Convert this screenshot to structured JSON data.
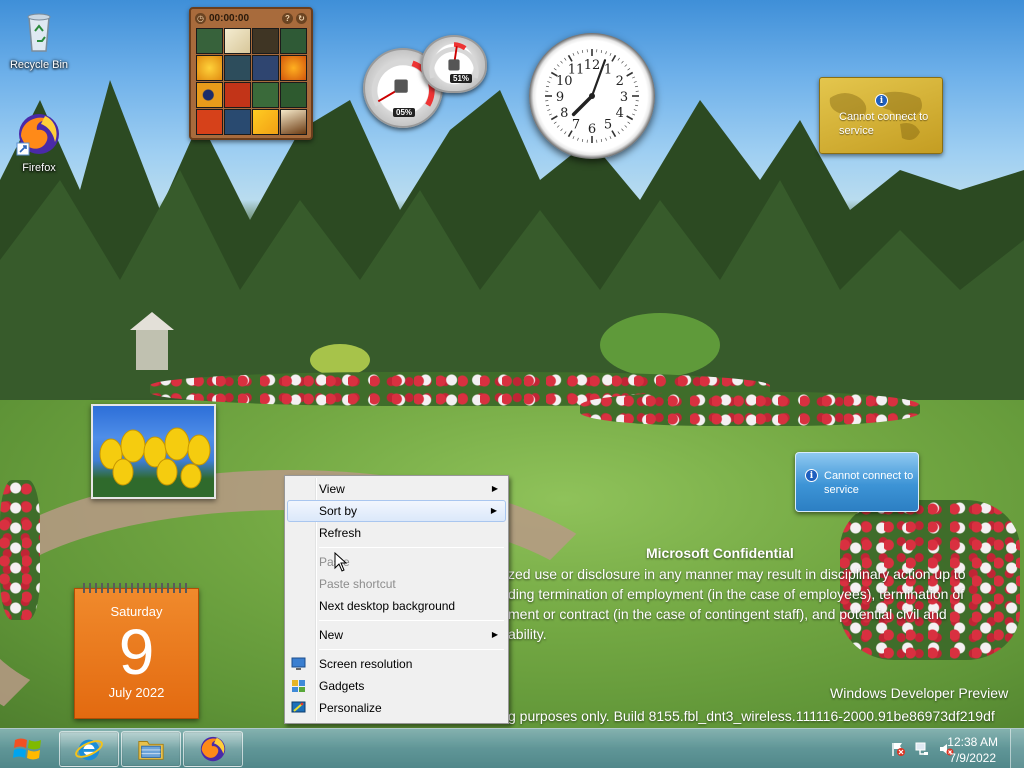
{
  "desktop": {
    "icons": [
      {
        "label": "Recycle Bin",
        "icon": "recycle-bin-icon"
      },
      {
        "label": "Firefox",
        "icon": "firefox-icon"
      }
    ]
  },
  "gadgets": {
    "puzzle": {
      "timer": "00:00:00",
      "help_glyph": "?",
      "close_glyph": "↻"
    },
    "cpu_meter": {
      "cpu_label": "05%",
      "memory_label": "51%"
    },
    "clock": {
      "numbers": [
        "12",
        "1",
        "2",
        "3",
        "4",
        "5",
        "6",
        "7",
        "8",
        "9",
        "10",
        "11"
      ]
    },
    "weather": {
      "status": "Cannot connect to service"
    },
    "feed_headlines": {
      "status": "Cannot connect to service"
    },
    "calendar": {
      "weekday": "Saturday",
      "day": "9",
      "month_year": "July 2022"
    }
  },
  "watermark": {
    "title": "Microsoft Confidential",
    "line1": "zed use or disclosure in any manner may result in disciplinary action up to",
    "line2": "ding termination of employment (in the case of employees), termination of",
    "line3": "ment or contract (in the case of contingent staff), and potential civil and",
    "line4": "ability.",
    "product": "Windows Developer Preview",
    "build": "g purposes only. Build 8155.fbl_dnt3_wireless.111116-2000.91be86973df219df"
  },
  "context_menu": {
    "view": "View",
    "sort_by": "Sort by",
    "refresh": "Refresh",
    "paste": "Paste",
    "paste_shortcut": "Paste shortcut",
    "next_background": "Next desktop background",
    "new": "New",
    "screen_resolution": "Screen resolution",
    "gadgets": "Gadgets",
    "personalize": "Personalize"
  },
  "taskbar": {
    "pinned": [
      "internet-explorer-icon",
      "file-explorer-icon",
      "firefox-icon"
    ],
    "time": "12:38 AM",
    "date": "7/9/2022"
  },
  "colors": {
    "calendar_orange": "#e36a10",
    "weather_gold": "#c49d22",
    "feed_blue": "#3d94d6",
    "menu_hover": "#dbe8fa"
  }
}
